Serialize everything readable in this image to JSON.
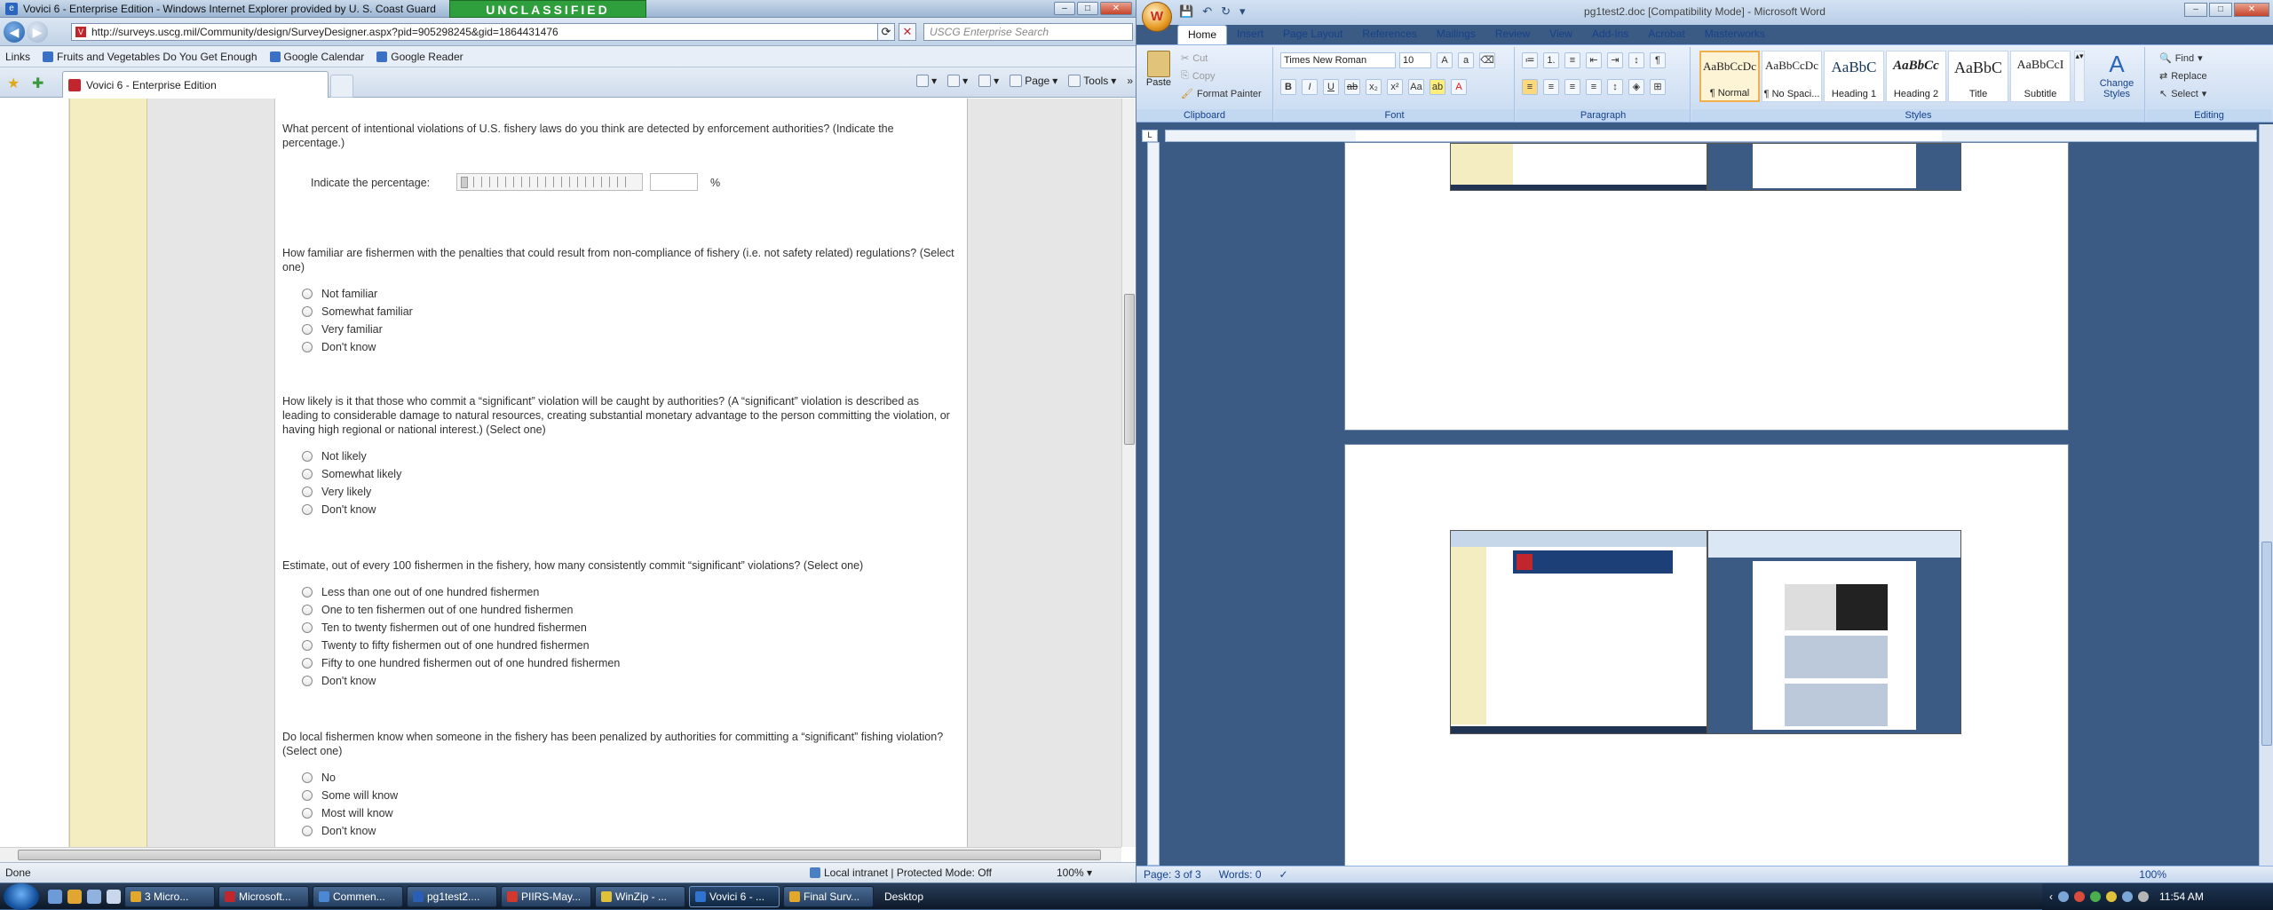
{
  "ie": {
    "title": "Vovici 6 - Enterprise Edition - Windows Internet Explorer provided by U. S. Coast Guard",
    "classification": "UNCLASSIFIED",
    "url": "http://surveys.uscg.mil/Community/design/SurveyDesigner.aspx?pid=905298245&gid=1864431476",
    "search_placeholder": "USCG Enterprise Search",
    "links_label": "Links",
    "favorites": [
      "Fruits and Vegetables Do You Get Enough",
      "Google Calendar",
      "Google Reader"
    ],
    "tab_title": "Vovici 6 - Enterprise Edition",
    "cmd": {
      "page": "Page",
      "tools": "Tools"
    },
    "status": {
      "left": "Done",
      "zone": "Local intranet | Protected Mode: Off",
      "zoom": "100%"
    }
  },
  "survey": {
    "q1": {
      "text": "What percent of intentional violations of U.S. fishery laws do you think are detected by enforcement authorities? (Indicate the percentage.)",
      "input_label": "Indicate the percentage:",
      "unit": "%"
    },
    "q2": {
      "text": "How familiar are fishermen with the penalties that could result from non-compliance of fishery (i.e. not safety related) regulations? (Select one)",
      "options": [
        "Not familiar",
        "Somewhat familiar",
        "Very familiar",
        "Don't know"
      ]
    },
    "q3": {
      "text": "How likely is it that those who commit a “significant” violation will be caught by authorities? (A “significant” violation is described as leading to considerable damage to natural resources, creating substantial monetary advantage to the person committing the violation, or having high regional or national interest.) (Select one)",
      "options": [
        "Not likely",
        "Somewhat likely",
        "Very likely",
        "Don't know"
      ]
    },
    "q4": {
      "text": "Estimate, out of every 100 fishermen in the fishery, how many consistently commit “significant” violations? (Select one)",
      "options": [
        "Less than one out of one hundred fishermen",
        "One to ten fishermen out of one hundred fishermen",
        "Ten to twenty fishermen out of one hundred fishermen",
        "Twenty to fifty fishermen out of one hundred fishermen",
        "Fifty to one hundred fishermen out of one hundred fishermen",
        "Don't know"
      ]
    },
    "q5": {
      "text": "Do local fishermen know when someone in the fishery has been penalized by authorities for committing a “significant” fishing violation? (Select one)",
      "options": [
        "No",
        "Some will know",
        "Most will know",
        "Don't know"
      ]
    }
  },
  "word": {
    "title": "pg1test2.doc [Compatibility Mode] - Microsoft Word",
    "tabs": [
      "Home",
      "Insert",
      "Page Layout",
      "References",
      "Mailings",
      "Review",
      "View",
      "Add-Ins",
      "Acrobat",
      "Masterworks"
    ],
    "clipboard": {
      "paste": "Paste",
      "cut": "Cut",
      "copy": "Copy",
      "format_painter": "Format Painter",
      "label": "Clipboard"
    },
    "font": {
      "name": "Times New Roman",
      "size": "10",
      "label": "Font"
    },
    "paragraph_label": "Paragraph",
    "styles": [
      {
        "preview": "AaBbCcDc",
        "name": "¶ Normal"
      },
      {
        "preview": "AaBbCcDc",
        "name": "¶ No Spaci..."
      },
      {
        "preview": "AaBbC",
        "name": "Heading 1"
      },
      {
        "preview": "AaBbCc",
        "name": "Heading 2"
      },
      {
        "preview": "AaBbC",
        "name": "Title"
      },
      {
        "preview": "AaBbCcI",
        "name": "Subtitle"
      }
    ],
    "styles_label": "Styles",
    "change_styles": "Change Styles",
    "editing": {
      "find": "Find",
      "replace": "Replace",
      "select": "Select",
      "label": "Editing"
    },
    "status": {
      "page": "Page: 3 of 3",
      "words": "Words: 0",
      "zoom": "100%"
    }
  },
  "taskbar": {
    "buttons": [
      "3 Micro...",
      "Microsoft...",
      "Commen...",
      "pg1test2....",
      "PIIRS-May...",
      "WinZip - ...",
      "Vovici 6 - ...",
      "Final Surv..."
    ],
    "desktop": "Desktop",
    "time": "11:54 AM"
  },
  "colors": {
    "ie_accent": "#c0262b",
    "banner": "#2f9e3c",
    "survey_left": "#f3edc1",
    "word_bg": "#3b5b84"
  }
}
